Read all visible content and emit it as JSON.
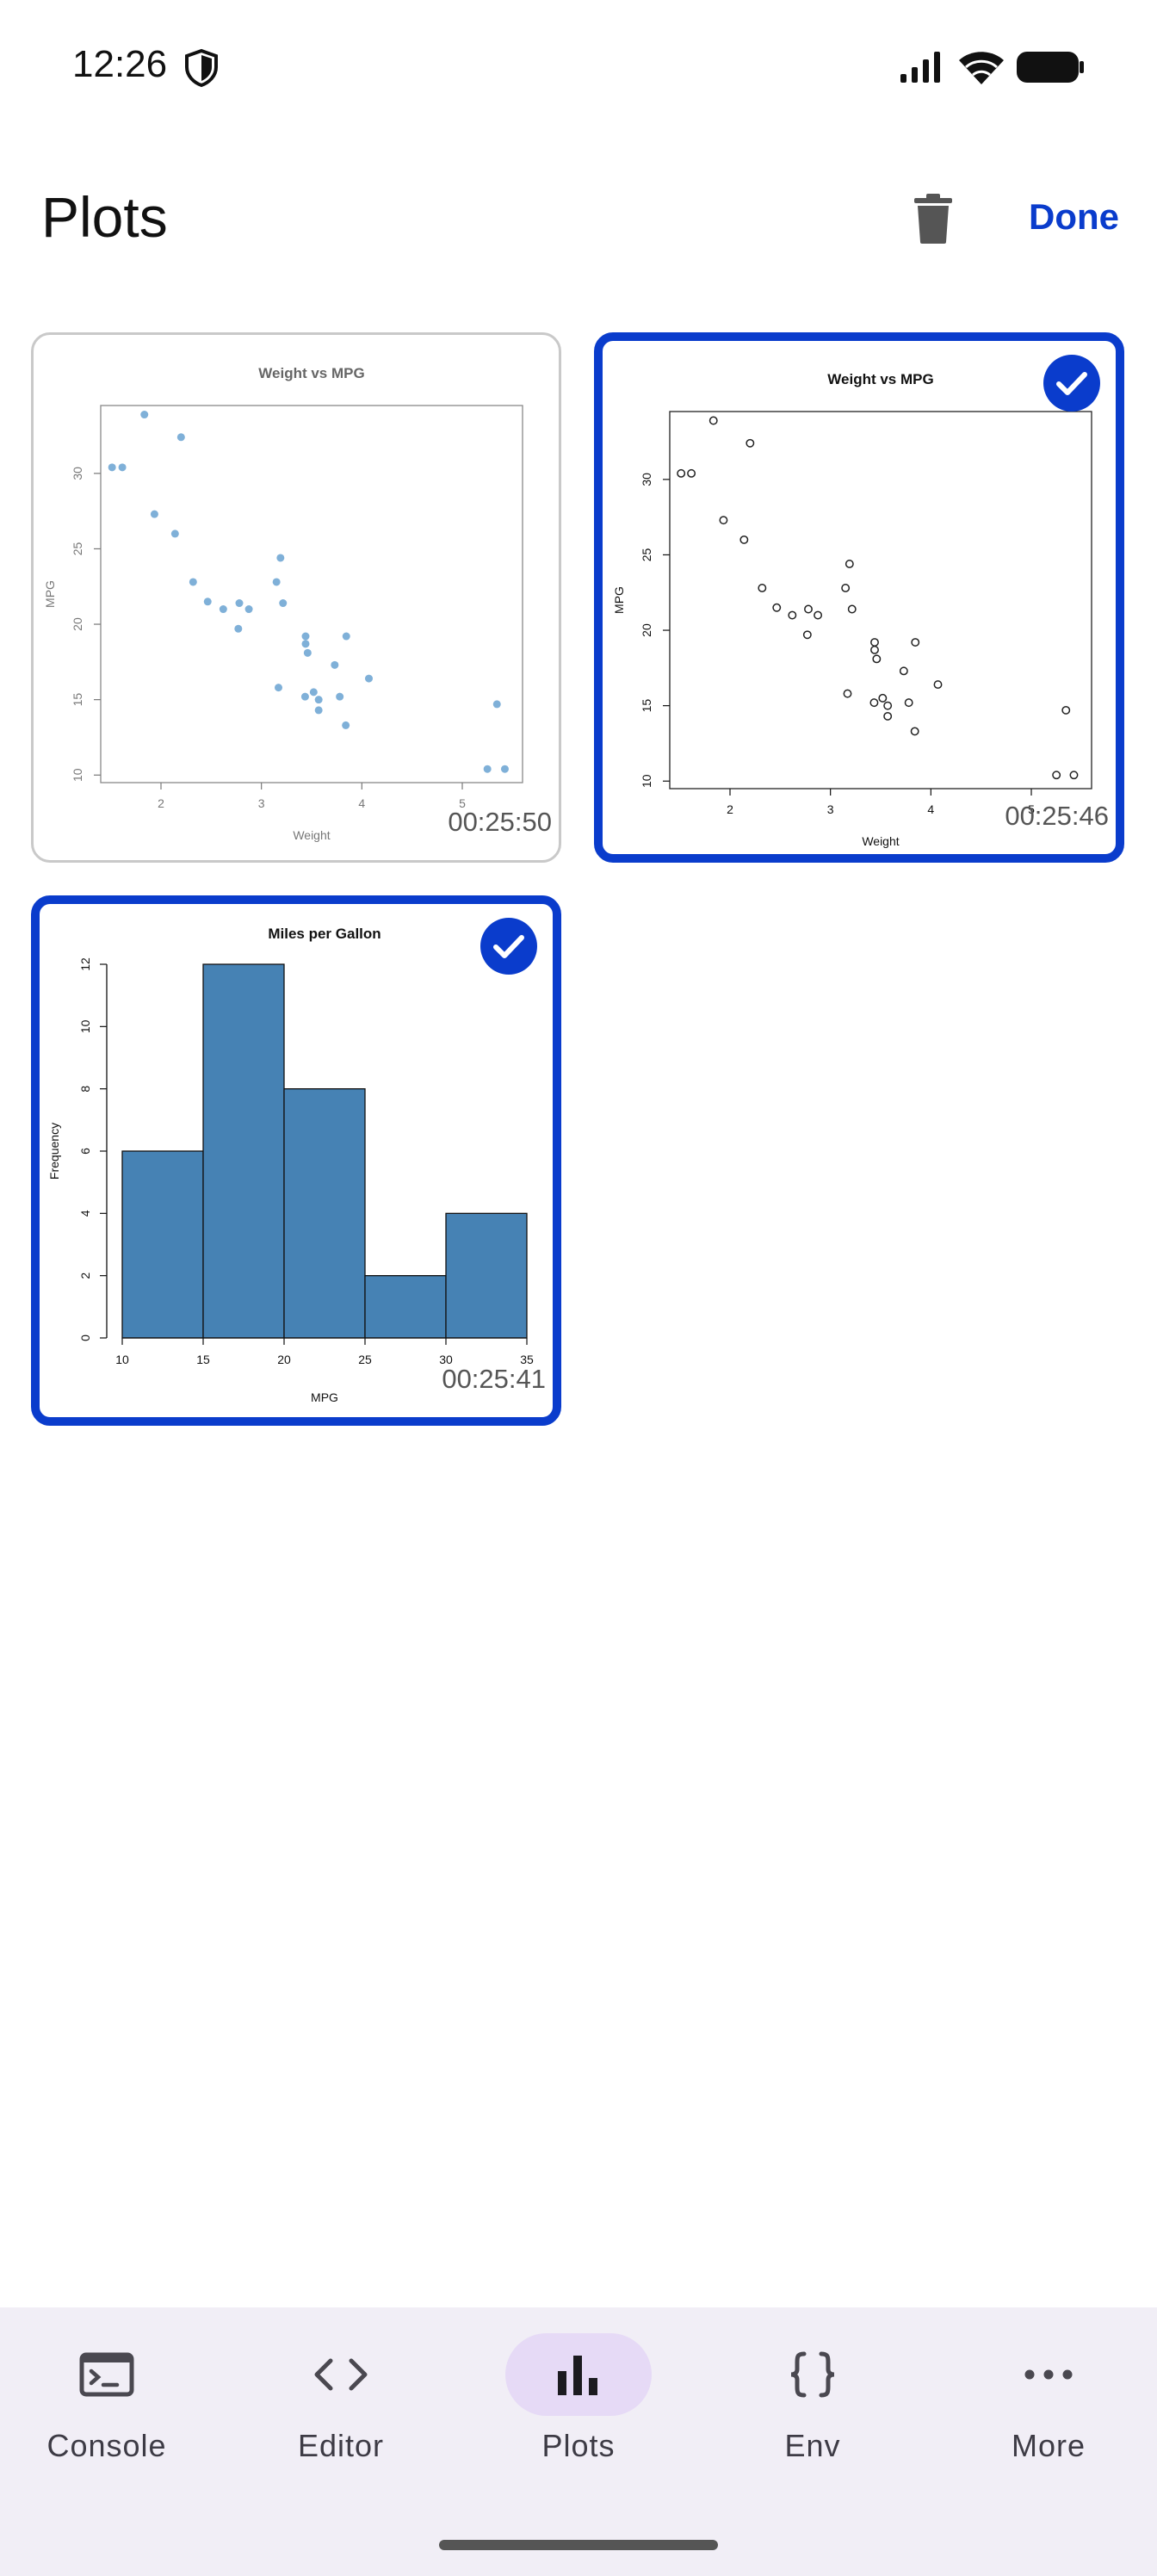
{
  "status": {
    "time": "12:26"
  },
  "header": {
    "title": "Plots",
    "done_label": "Done"
  },
  "plots": [
    {
      "selected": false,
      "timestamp": "00:25:50",
      "chart": {
        "title": "Weight vs MPG",
        "xlabel": "Weight",
        "ylabel": "MPG"
      }
    },
    {
      "selected": true,
      "timestamp": "00:25:46",
      "chart": {
        "title": "Weight vs MPG",
        "xlabel": "Weight",
        "ylabel": "MPG"
      }
    },
    {
      "selected": true,
      "timestamp": "00:25:41",
      "chart": {
        "title": "Miles per Gallon",
        "xlabel": "MPG",
        "ylabel": "Frequency"
      }
    }
  ],
  "chart_data": [
    {
      "type": "scatter",
      "title": "Weight vs MPG",
      "xlabel": "Weight",
      "ylabel": "MPG",
      "xlim": [
        1.4,
        5.6
      ],
      "ylim": [
        9.5,
        34.5
      ],
      "x_ticks": [
        2,
        3,
        4,
        5
      ],
      "y_ticks": [
        10,
        15,
        20,
        25,
        30
      ],
      "color": "#7fb0d8",
      "points": [
        [
          1.513,
          30.4
        ],
        [
          1.615,
          30.4
        ],
        [
          1.835,
          33.9
        ],
        [
          1.935,
          27.3
        ],
        [
          2.14,
          26.0
        ],
        [
          2.2,
          32.4
        ],
        [
          2.32,
          22.8
        ],
        [
          2.465,
          21.5
        ],
        [
          2.62,
          21.0
        ],
        [
          2.77,
          19.7
        ],
        [
          2.78,
          21.4
        ],
        [
          2.875,
          21.0
        ],
        [
          3.15,
          22.8
        ],
        [
          3.17,
          15.8
        ],
        [
          3.19,
          24.4
        ],
        [
          3.215,
          21.4
        ],
        [
          3.435,
          15.2
        ],
        [
          3.44,
          18.7
        ],
        [
          3.44,
          19.2
        ],
        [
          3.46,
          18.1
        ],
        [
          3.52,
          15.5
        ],
        [
          3.57,
          15.0
        ],
        [
          3.57,
          14.3
        ],
        [
          3.73,
          17.3
        ],
        [
          3.78,
          15.2
        ],
        [
          3.84,
          13.3
        ],
        [
          3.845,
          19.2
        ],
        [
          4.07,
          16.4
        ],
        [
          5.25,
          10.4
        ],
        [
          5.345,
          14.7
        ],
        [
          5.424,
          10.4
        ]
      ]
    },
    {
      "type": "scatter",
      "title": "Weight vs MPG",
      "xlabel": "Weight",
      "ylabel": "MPG",
      "xlim": [
        1.4,
        5.6
      ],
      "ylim": [
        9.5,
        34.5
      ],
      "x_ticks": [
        2,
        3,
        4,
        5
      ],
      "y_ticks": [
        10,
        15,
        20,
        25,
        30
      ],
      "color": "#222222",
      "points": [
        [
          1.513,
          30.4
        ],
        [
          1.615,
          30.4
        ],
        [
          1.835,
          33.9
        ],
        [
          1.935,
          27.3
        ],
        [
          2.14,
          26.0
        ],
        [
          2.2,
          32.4
        ],
        [
          2.32,
          22.8
        ],
        [
          2.465,
          21.5
        ],
        [
          2.62,
          21.0
        ],
        [
          2.77,
          19.7
        ],
        [
          2.78,
          21.4
        ],
        [
          2.875,
          21.0
        ],
        [
          3.15,
          22.8
        ],
        [
          3.17,
          15.8
        ],
        [
          3.19,
          24.4
        ],
        [
          3.215,
          21.4
        ],
        [
          3.435,
          15.2
        ],
        [
          3.44,
          18.7
        ],
        [
          3.44,
          19.2
        ],
        [
          3.46,
          18.1
        ],
        [
          3.52,
          15.5
        ],
        [
          3.57,
          15.0
        ],
        [
          3.57,
          14.3
        ],
        [
          3.73,
          17.3
        ],
        [
          3.78,
          15.2
        ],
        [
          3.84,
          13.3
        ],
        [
          3.845,
          19.2
        ],
        [
          4.07,
          16.4
        ],
        [
          5.25,
          10.4
        ],
        [
          5.345,
          14.7
        ],
        [
          5.424,
          10.4
        ]
      ]
    },
    {
      "type": "bar",
      "title": "Miles per Gallon",
      "xlabel": "MPG",
      "ylabel": "Frequency",
      "bins": [
        10,
        15,
        20,
        25,
        30,
        35
      ],
      "values": [
        6,
        12,
        8,
        2,
        4
      ],
      "xlim": [
        10,
        35
      ],
      "ylim": [
        0,
        12
      ],
      "x_ticks": [
        10,
        15,
        20,
        25,
        30,
        35
      ],
      "y_ticks": [
        0,
        2,
        4,
        6,
        8,
        10,
        12
      ],
      "color": "#4682b4"
    }
  ],
  "bottom_nav": {
    "items": [
      {
        "label": "Console",
        "icon": "console-icon",
        "active": false
      },
      {
        "label": "Editor",
        "icon": "code-icon",
        "active": false
      },
      {
        "label": "Plots",
        "icon": "bar-chart-icon",
        "active": true
      },
      {
        "label": "Env",
        "icon": "braces-icon",
        "active": false
      },
      {
        "label": "More",
        "icon": "more-icon",
        "active": false
      }
    ]
  },
  "colors": {
    "accent": "#0a3ccc",
    "nav_bg": "#f1eef6",
    "nav_active": "#e6daf6"
  }
}
